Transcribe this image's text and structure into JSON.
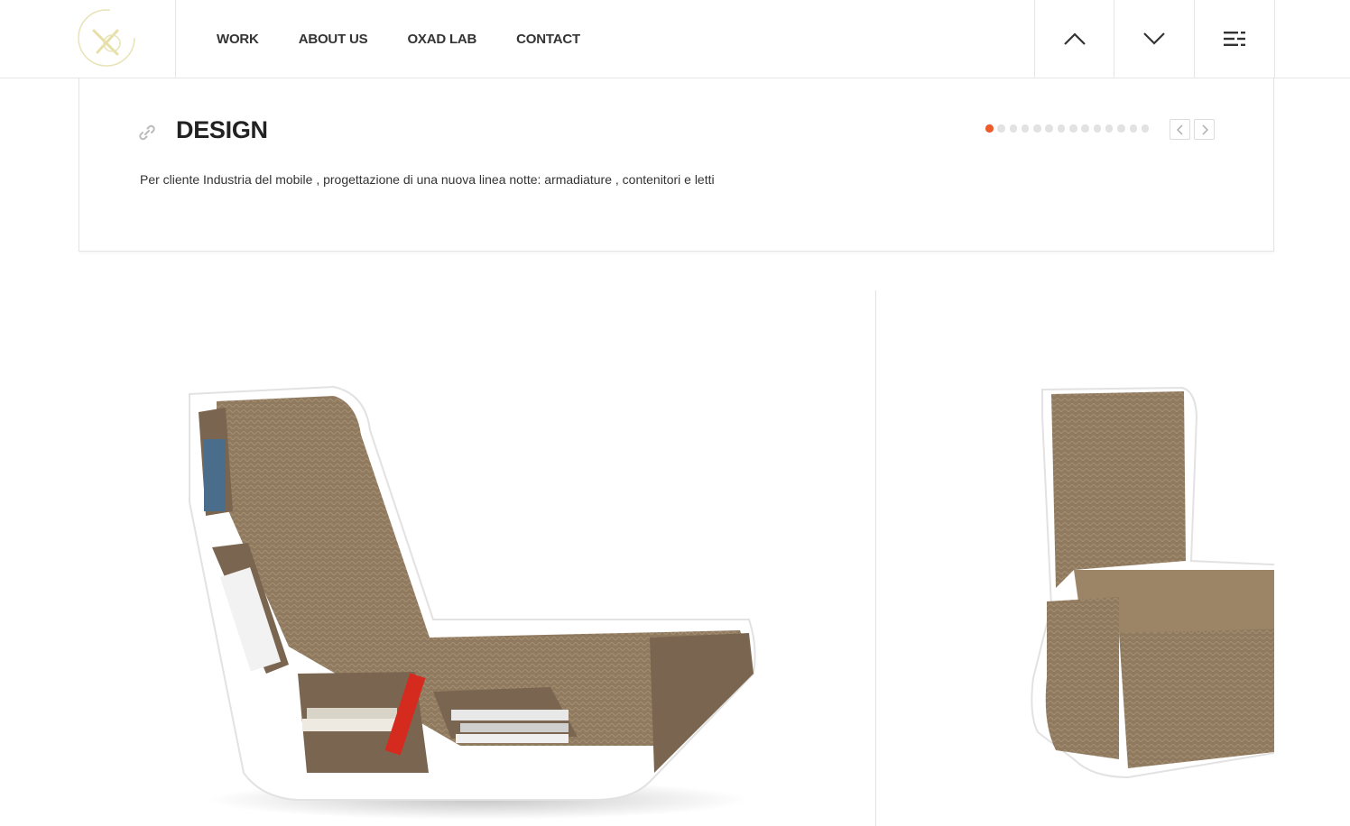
{
  "header": {
    "nav": [
      "WORK",
      "ABOUT US",
      "OXAD LAB",
      "CONTACT"
    ]
  },
  "project": {
    "title": "DESIGN",
    "description": "Per cliente Industria del mobile , progettazione di una nuova linea notte: armadiature , contenitori e letti",
    "slide_count": 14,
    "active_slide": 1
  },
  "colors": {
    "accent": "#ee5a2a",
    "cardboard": "#8f7a60",
    "frame": "#ffffff",
    "logo": "#e6e2b4"
  }
}
